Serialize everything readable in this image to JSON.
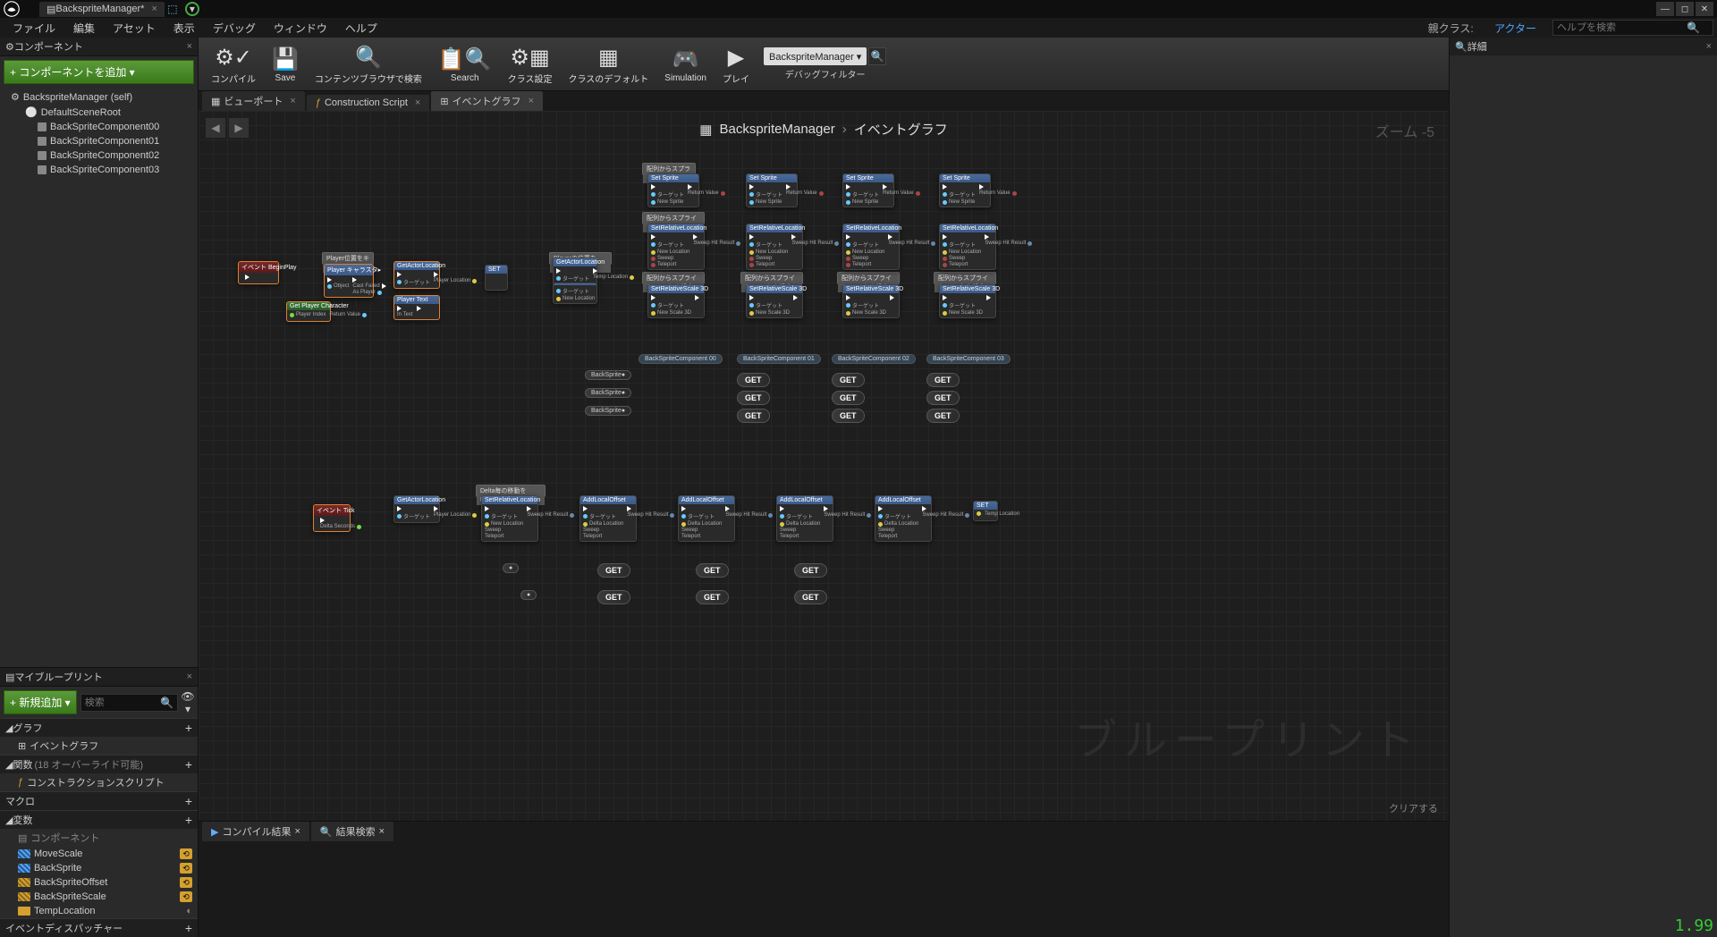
{
  "title_tab": "BackspriteManager*",
  "menu": [
    "ファイル",
    "編集",
    "アセット",
    "表示",
    "デバッグ",
    "ウィンドウ",
    "ヘルプ"
  ],
  "parent_class_label": "親クラス:",
  "parent_class": "アクター",
  "search_placeholder": "ヘルプを検索",
  "components": {
    "panel_title": "コンポーネント",
    "add_button": "+ コンポーネントを追加 ▾",
    "root": "BackspriteManager (self)",
    "scene_root": "DefaultSceneRoot",
    "children": [
      "BackSpriteComponent00",
      "BackSpriteComponent01",
      "BackSpriteComponent02",
      "BackSpriteComponent03"
    ]
  },
  "mybp": {
    "panel_title": "マイブループリント",
    "add_new": "+ 新規追加 ▾",
    "search_placeholder": "検索",
    "categories": {
      "graph": "グラフ",
      "event_graph": "イベントグラフ",
      "functions": "関数",
      "functions_hint": "(18 オーバーライド可能)",
      "construction": "コンストラクションスクリプト",
      "macro": "マクロ",
      "variables": "変数",
      "components_cat": "コンポーネント",
      "dispatcher": "イベントディスパッチャー"
    },
    "variables": [
      "MoveScale",
      "BackSprite",
      "BackSpriteOffset",
      "BackSpriteScale",
      "TempLocation"
    ]
  },
  "toolbar": {
    "compile": "コンパイル",
    "save": "Save",
    "browse": "コンテンツブラウザで検索",
    "search": "Search",
    "class_settings": "クラス設定",
    "class_defaults": "クラスのデフォルト",
    "simulation": "Simulation",
    "play": "プレイ",
    "debug_filter_label": "デバッグフィルター",
    "debug_filter_value": "BackspriteManager ▾"
  },
  "editor_tabs": {
    "viewport": "ビューポート",
    "construction": "Construction Script",
    "event_graph": "イベントグラフ"
  },
  "breadcrumb": {
    "root": "BackspriteManager",
    "leaf": "イベントグラフ"
  },
  "zoom": "ズーム -5",
  "watermark": "ブループリント",
  "clear": "クリアする",
  "bottom_tabs": {
    "compile_results": "コンパイル結果",
    "result_search": "結果検索"
  },
  "details": {
    "title": "詳細"
  },
  "nodes": {
    "begin_play": "イベント BeginPlay",
    "tick": "イベント Tick",
    "delta": "Delta Seconds",
    "cast": "Player キャラスタ▸",
    "get_player_char": "Get Player Character",
    "player_index": "Player Index",
    "return_value": "Return Value",
    "set": "SET",
    "get": "GET",
    "temp_location": "Temp Location",
    "set_sprite": "Set Sprite",
    "new_sprite": "New Sprite",
    "target": "ターゲット",
    "set_relative_loc": "SetRelativeLocation",
    "new_location": "New Location",
    "sweep": "Sweep",
    "teleport": "Teleport",
    "sweep_hit": "Sweep Hit Result",
    "set_relative_scale": "SetRelativeScale 3D",
    "new_scale": "New Scale 3D",
    "add_local_offset": "AddLocalOffset",
    "delta_location": "Delta Location",
    "get_actor_loc": "GetActorLocation",
    "comment1": "配列からスプライトを設定",
    "comment2": "配列からスプライトの位置を初期化",
    "comment3": "配列からスプライトのScaleを設定",
    "comment4": "Player位置をキャストする",
    "comment5": "Playerの位置をLocationで取得",
    "comment6": "Delta毎の移動をPlayerに追従"
  },
  "fps": "1.99"
}
